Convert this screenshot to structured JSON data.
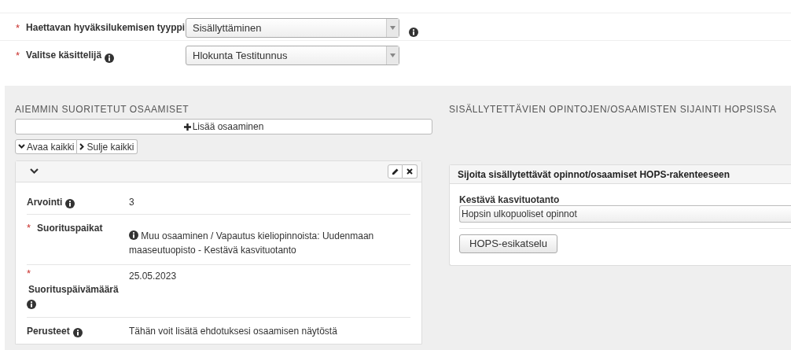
{
  "form_fields": [
    {
      "required_mark": "*",
      "label": "Haettavan hyväksilukemisen tyyppi",
      "label_info": false,
      "value": "Sisällyttäminen",
      "after_info": true
    },
    {
      "required_mark": "*",
      "label": "Valitse käsittelijä",
      "label_info": true,
      "value": "Hlokunta Testitunnus",
      "after_info": false
    }
  ],
  "left_section": {
    "heading": "AIEMMIN SUORITETUT OSAAMISET",
    "add_button": "Lisää osaaminen",
    "expand_all": "Avaa kaikki",
    "collapse_all": "Sulje kaikki",
    "card": {
      "expanded": true,
      "rows": [
        {
          "label": "Arvointi",
          "required_mark": null,
          "label_info": true,
          "value": "3",
          "value_info": false
        },
        {
          "label": "Suorituspaikat",
          "required_mark": "*",
          "label_info": false,
          "value": "Muu osaaminen / Vapautus kieliopinnoista: Uudenmaan maaseutuopisto - Kestävä kasvituotanto",
          "value_info": true
        },
        {
          "label": "Suorituspäivämäärä",
          "required_mark": "*",
          "label_info": true,
          "value": "25.05.2023",
          "value_info": false,
          "stacked": true
        },
        {
          "label": "Perusteet",
          "required_mark": null,
          "label_info": true,
          "value": "Tähän voit lisätä ehdotuksesi osaamisen näytöstä",
          "value_info": false
        }
      ]
    }
  },
  "right_section": {
    "heading": "SISÄLLYTETTÄVIEN OPINTOJEN/OSAAMISTEN SIJAINTI HOPSISSA",
    "card_title": "Sijoita sisällytettävät opinnot/osaamiset HOPS-rakenteeseen",
    "group_label": "Kestävä kasvituotanto",
    "select_value": "Hopsin ulkopuoliset opinnot",
    "preview_button": "HOPS-esikatselu"
  }
}
